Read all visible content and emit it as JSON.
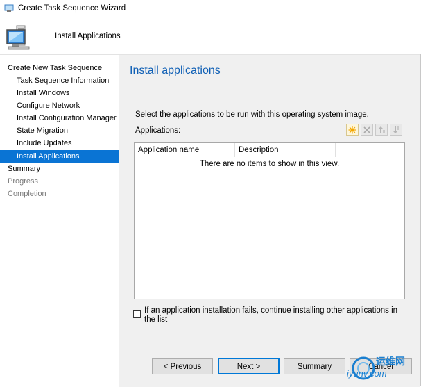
{
  "window": {
    "title": "Create Task Sequence Wizard"
  },
  "header": {
    "title": "Install Applications"
  },
  "nav": {
    "items": [
      {
        "label": "Create New Task Sequence",
        "level": 0,
        "state": "normal"
      },
      {
        "label": "Task Sequence Information",
        "level": 1,
        "state": "normal"
      },
      {
        "label": "Install Windows",
        "level": 1,
        "state": "normal"
      },
      {
        "label": "Configure Network",
        "level": 1,
        "state": "normal"
      },
      {
        "label": "Install Configuration Manager",
        "level": 1,
        "state": "normal"
      },
      {
        "label": "State Migration",
        "level": 1,
        "state": "normal"
      },
      {
        "label": "Include Updates",
        "level": 1,
        "state": "normal"
      },
      {
        "label": "Install Applications",
        "level": 1,
        "state": "active"
      },
      {
        "label": "Summary",
        "level": 0,
        "state": "normal"
      },
      {
        "label": "Progress",
        "level": 0,
        "state": "disabled"
      },
      {
        "label": "Completion",
        "level": 0,
        "state": "disabled"
      }
    ]
  },
  "content": {
    "title": "Install applications",
    "description": "Select the applications to be run with this operating system image.",
    "apps_label": "Applications:",
    "toolbar": [
      {
        "icon": "new-star-icon",
        "glyph": "✸",
        "enabled": true
      },
      {
        "icon": "delete-x-icon",
        "glyph": "✕",
        "enabled": false
      },
      {
        "icon": "move-up-icon",
        "glyph": "⇡",
        "enabled": false
      },
      {
        "icon": "move-down-icon",
        "glyph": "⇣",
        "enabled": false
      }
    ],
    "list": {
      "columns": [
        "Application name",
        "Description"
      ],
      "empty_message": "There are no items to show in this view."
    },
    "continue_on_fail": {
      "label": "If an application installation fails, continue installing other applications in the list",
      "checked": false
    }
  },
  "buttons": {
    "previous": "< Previous",
    "next": "Next >",
    "summary": "Summary",
    "cancel": "Cancel"
  },
  "watermark": {
    "line1": "运维网",
    "line2": "iyunv.com"
  },
  "colors": {
    "accent": "#0a74d4",
    "title_blue": "#0f5fb5"
  }
}
